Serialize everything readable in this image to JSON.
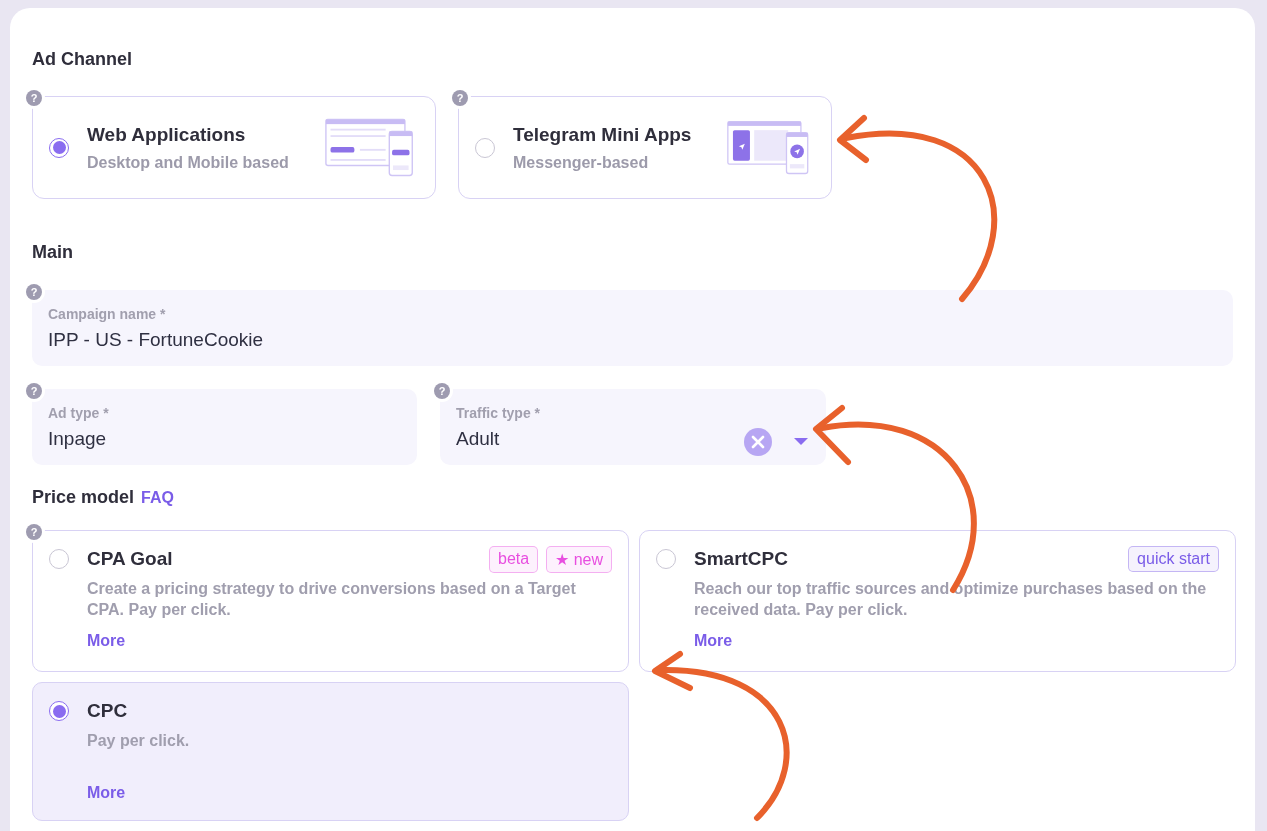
{
  "ad_channel": {
    "title": "Ad Channel",
    "options": [
      {
        "kind": "web",
        "title": "Web Applications",
        "subtitle": "Desktop and Mobile based",
        "selected": true,
        "help": "?"
      },
      {
        "kind": "telegram",
        "title": "Telegram Mini Apps",
        "subtitle": "Messenger-based",
        "selected": false,
        "help": "?"
      }
    ]
  },
  "main": {
    "title": "Main",
    "fields": [
      {
        "kind": "text",
        "label": "Campaign name *",
        "value": "IPP - US - FortuneCookie",
        "help": "?"
      },
      {
        "kind": "text",
        "label": "Ad type *",
        "value": "Inpage",
        "help": "?"
      },
      {
        "kind": "select",
        "label": "Traffic type *",
        "value": "Adult",
        "help": "?",
        "clearable": true
      }
    ]
  },
  "price_model": {
    "title": "Price model",
    "link": "FAQ",
    "help": "?",
    "options": [
      {
        "title": "CPA Goal",
        "description": "Create a pricing strategy to drive conversions based on a Target CPA. Pay per click.",
        "link": "More",
        "selected": false,
        "tags": [
          {
            "text": "beta",
            "color": "#e84ee0"
          },
          {
            "text": "★ new",
            "color": "#e84ee0"
          }
        ]
      },
      {
        "title": "SmartCPC",
        "description": "Reach our top traffic sources and optimize purchases based on the received data. Pay per click.",
        "link": "More",
        "selected": false,
        "tags": [
          {
            "text": "quick start",
            "color": "#7a5ce8"
          }
        ]
      },
      {
        "title": "CPC",
        "description": "Pay per click.",
        "link": "More",
        "selected": true
      }
    ]
  }
}
